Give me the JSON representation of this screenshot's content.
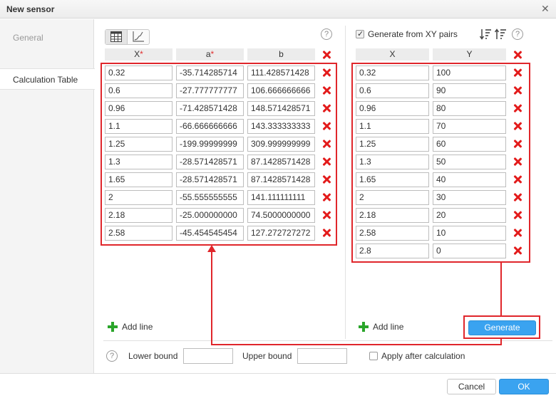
{
  "dialog": {
    "title": "New sensor"
  },
  "sidebar": {
    "items": [
      {
        "label": "General"
      },
      {
        "label": "Calculation Table"
      }
    ]
  },
  "left_table": {
    "headers": {
      "x": "X",
      "a": "a",
      "b": "b",
      "required_mark": "*"
    },
    "rows": [
      [
        "0.32",
        "-35.714285714",
        "111.428571428"
      ],
      [
        "0.6",
        "-27.777777777",
        "106.666666666"
      ],
      [
        "0.96",
        "-71.428571428",
        "148.571428571"
      ],
      [
        "1.1",
        "-66.666666666",
        "143.333333333"
      ],
      [
        "1.25",
        "-199.99999999",
        "309.999999999"
      ],
      [
        "1.3",
        "-28.571428571",
        "87.1428571428"
      ],
      [
        "1.65",
        "-28.571428571",
        "87.1428571428"
      ],
      [
        "2",
        "-55.555555555",
        "141.111111111"
      ],
      [
        "2.18",
        "-25.000000000",
        "74.5000000000"
      ],
      [
        "2.58",
        "-45.454545454",
        "127.272727272"
      ]
    ],
    "add_line_label": "Add line"
  },
  "right_table": {
    "generate_checkbox_label": "Generate from XY pairs",
    "generate_checked": true,
    "headers": {
      "x": "X",
      "y": "Y"
    },
    "rows": [
      [
        "0.32",
        "100"
      ],
      [
        "0.6",
        "90"
      ],
      [
        "0.96",
        "80"
      ],
      [
        "1.1",
        "70"
      ],
      [
        "1.25",
        "60"
      ],
      [
        "1.3",
        "50"
      ],
      [
        "1.65",
        "40"
      ],
      [
        "2",
        "30"
      ],
      [
        "2.18",
        "20"
      ],
      [
        "2.58",
        "10"
      ],
      [
        "2.8",
        "0"
      ]
    ],
    "add_line_label": "Add line",
    "generate_button_label": "Generate"
  },
  "bounds": {
    "lower_label": "Lower bound",
    "lower_value": "",
    "upper_label": "Upper bound",
    "upper_value": "",
    "apply_after_label": "Apply after calculation",
    "apply_after_checked": false
  },
  "help_icon_glyph": "?",
  "footer": {
    "cancel_label": "Cancel",
    "ok_label": "OK"
  },
  "colors": {
    "accent": "#3aa3f0",
    "delete": "#e31b1b",
    "annotation": "#e0262b",
    "add": "#2aa52a"
  }
}
